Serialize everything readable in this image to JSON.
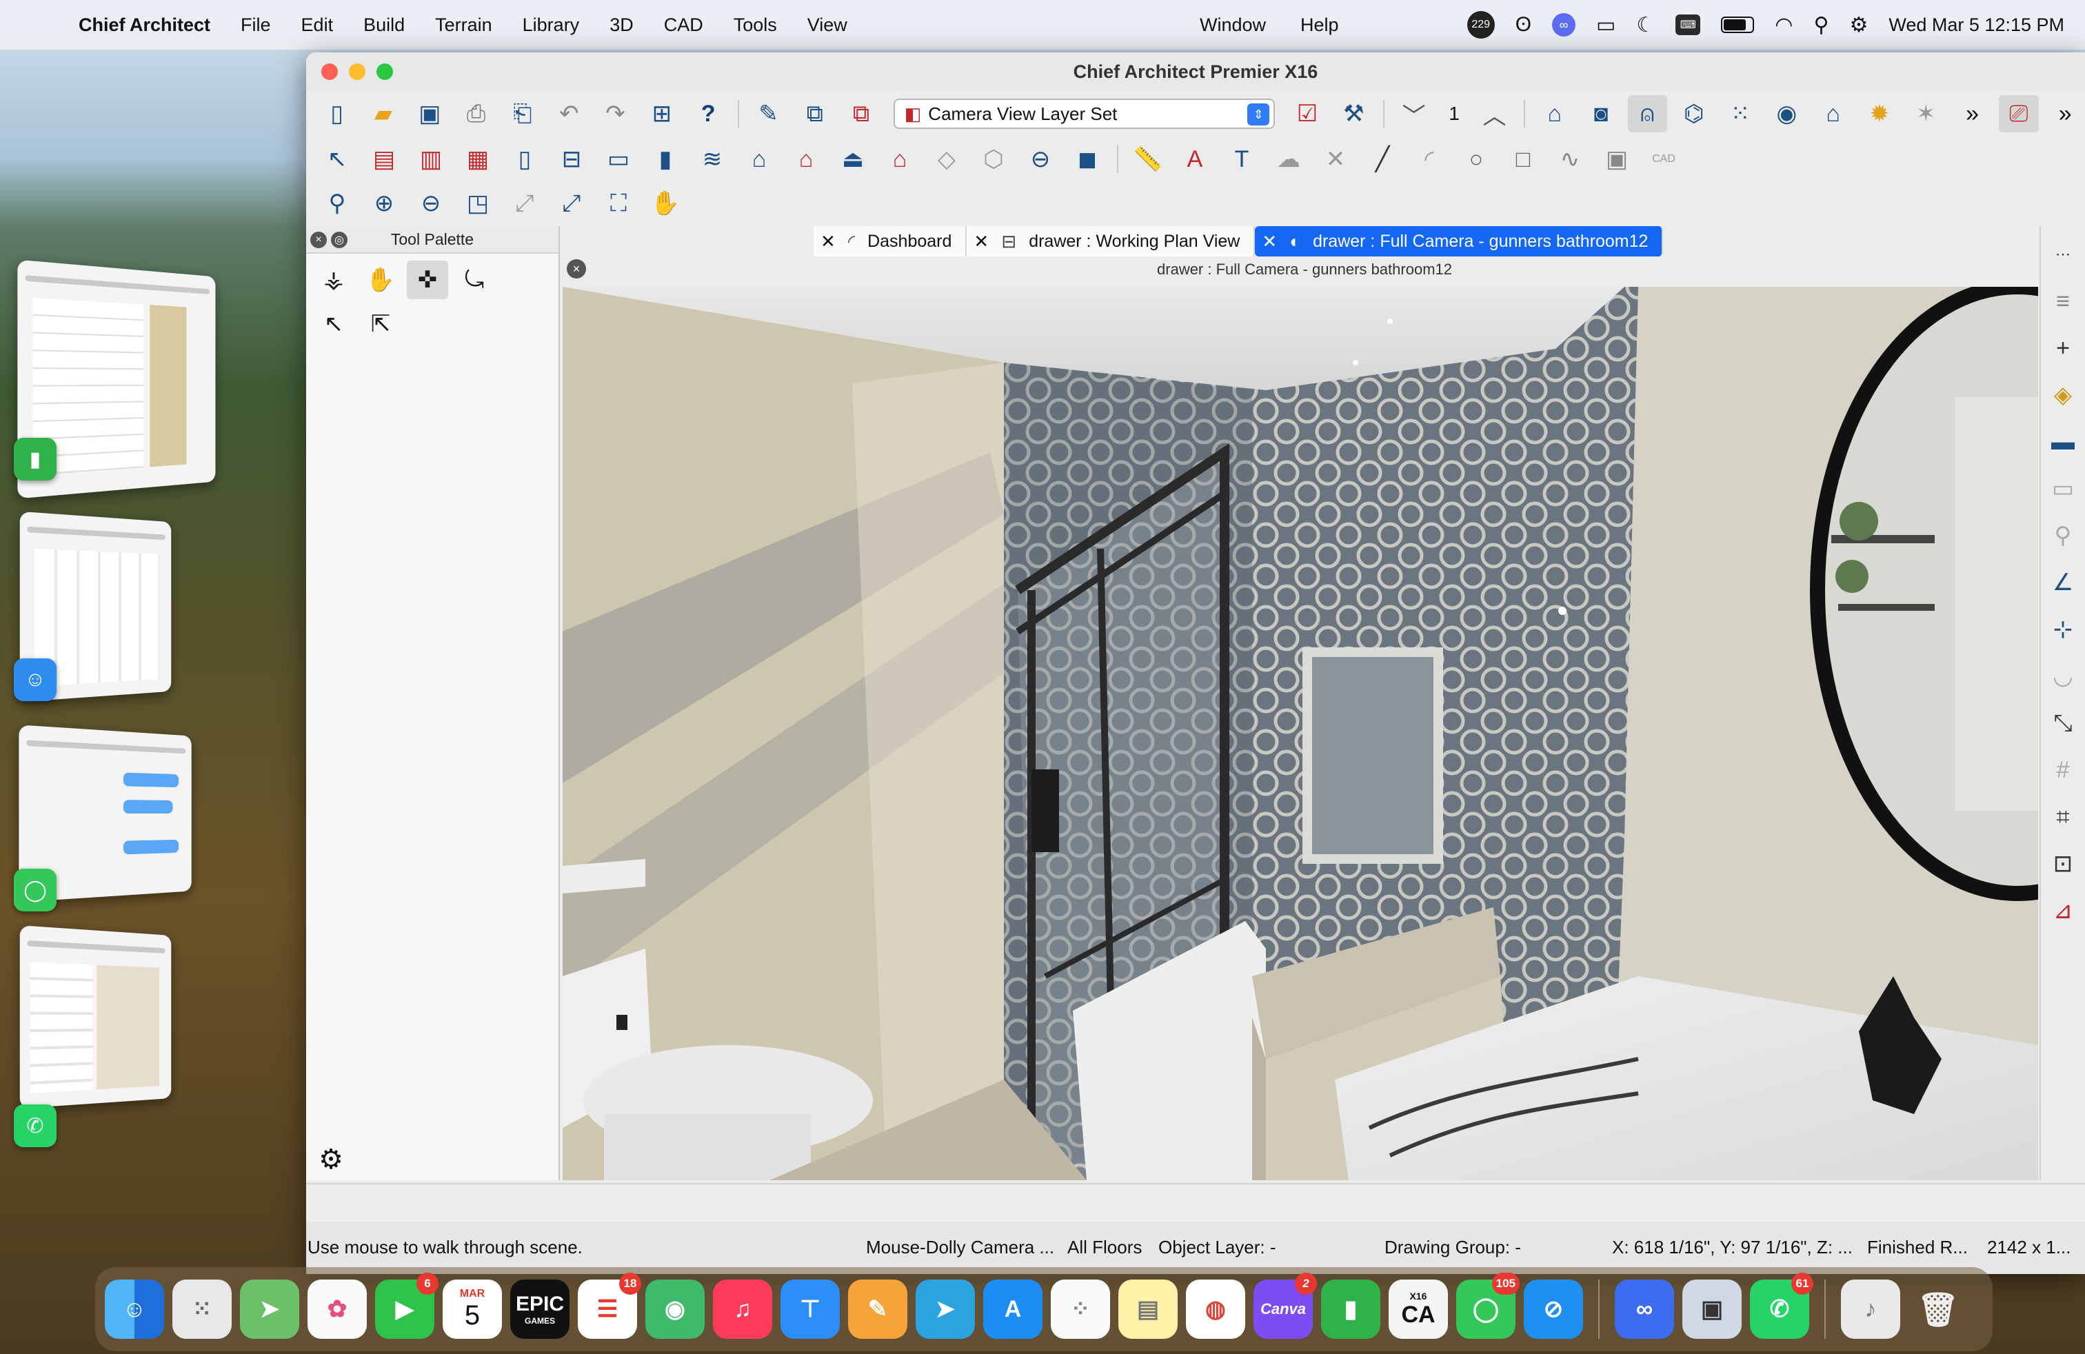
{
  "menubar": {
    "apple_icon": "apple-logo",
    "app_name": "Chief Architect",
    "items": [
      "File",
      "Edit",
      "Build",
      "Terrain",
      "Library",
      "3D",
      "CAD",
      "Tools",
      "View"
    ],
    "right_items": [
      "Window",
      "Help"
    ],
    "badge_count": "229",
    "datetime": "Wed Mar 5  12:15 PM"
  },
  "window": {
    "title": "Chief Architect Premier X16",
    "layer_set": "Camera View Layer Set",
    "floor_number": "1"
  },
  "palette": {
    "title": "Tool Palette"
  },
  "tabs": [
    {
      "label": "Dashboard",
      "icon": "dashboard-icon"
    },
    {
      "label": "drawer :  Working Plan View",
      "icon": "plan-view-icon"
    },
    {
      "label": "drawer : Full Camera - gunners bathroom12",
      "icon": "camera-icon"
    }
  ],
  "view_title": "drawer : Full Camera - gunners bathroom12",
  "status": {
    "hint": "Use mouse to walk through scene.",
    "mode": "Mouse-Dolly Camera ...",
    "floors": "All Floors",
    "object_layer": "Object Layer: -",
    "drawing_group": "Drawing Group: -",
    "coords": "X: 618 1/16\", Y: 97 1/16\", Z: ...",
    "finished": "Finished R...",
    "size": "2142 x 1..."
  },
  "dock": {
    "calendar_month": "MAR",
    "calendar_day": "5",
    "epic_label": "EPIC",
    "epic_sub": "GAMES",
    "canva_label": "Canva",
    "ca_label": "CA",
    "ca_version": "X16",
    "badges": {
      "facetime": "6",
      "reminders": "18",
      "canva": "2",
      "messages": "105",
      "whatsapp": "61"
    }
  },
  "colors": {
    "accent": "#1467f2",
    "toolbar_icon": "#1b4f86"
  }
}
